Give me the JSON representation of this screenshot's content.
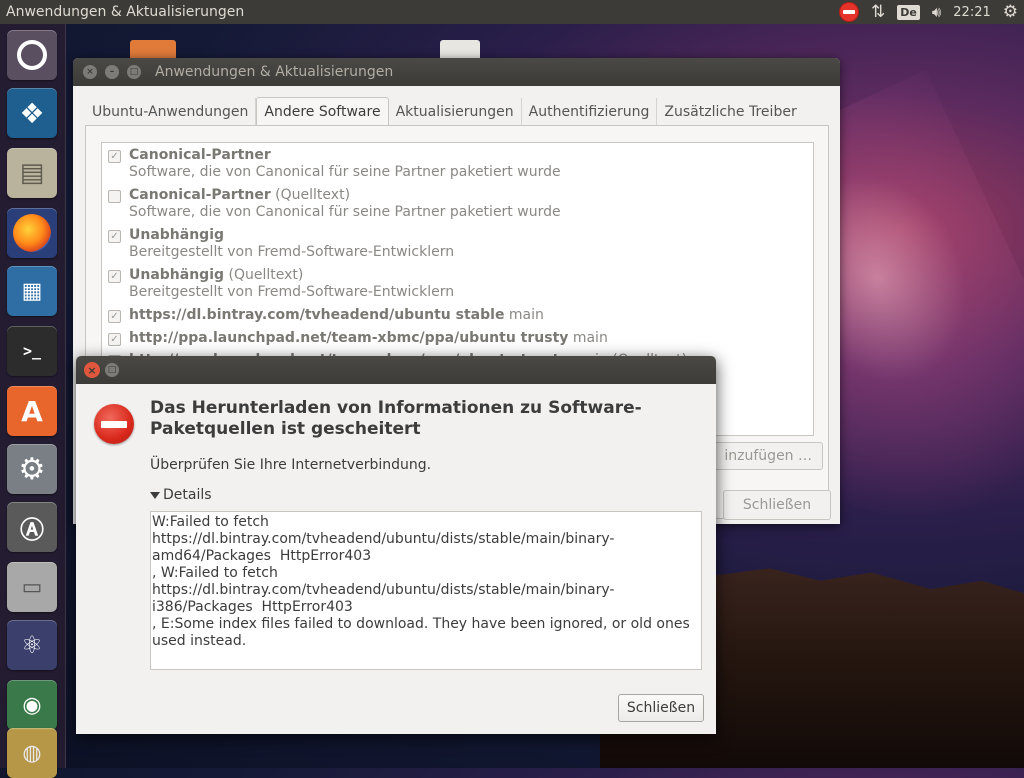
{
  "panel": {
    "title": "Anwendungen & Aktualisierungen",
    "keyboard_layout": "De",
    "clock": "22:21",
    "icons": [
      "network-error-icon",
      "transfer-icon",
      "keyboard-icon",
      "volume-icon",
      "gear-icon"
    ]
  },
  "launcher": {
    "items": [
      "dash-icon",
      "kodi-icon",
      "file-manager-icon",
      "firefox-icon",
      "writer-icon",
      "terminal-icon",
      "software-center-icon",
      "system-settings-icon",
      "software-updater-icon",
      "disk-icon",
      "media-icon",
      "app-icon",
      "app-icon"
    ]
  },
  "bg_window": {
    "title": "Anwendungen & Aktualisierungen",
    "tabs": [
      "Ubuntu-Anwendungen",
      "Andere Software",
      "Aktualisierungen",
      "Authentifizierung",
      "Zusätzliche Treiber"
    ],
    "active_tab": "Andere Software",
    "sources": [
      {
        "name": "Canonical-Partner",
        "suffix": "",
        "desc": "Software, die von Canonical für seine Partner paketiert wurde",
        "checked": true
      },
      {
        "name": "Canonical-Partner",
        "suffix": " (Quelltext)",
        "desc": "Software, die von Canonical für seine Partner paketiert wurde",
        "checked": false
      },
      {
        "name": "Unabhängig",
        "suffix": "",
        "desc": "Bereitgestellt von Fremd-Software-Entwicklern",
        "checked": true
      },
      {
        "name": "Unabhängig",
        "suffix": " (Quelltext)",
        "desc": "Bereitgestellt von Fremd-Software-Entwicklern",
        "checked": true
      },
      {
        "name": "https://dl.bintray.com/tvheadend/ubuntu stable",
        "suffix": " main",
        "desc": "",
        "checked": true
      },
      {
        "name": "http://ppa.launchpad.net/team-xbmc/ppa/ubuntu trusty",
        "suffix": " main",
        "desc": "",
        "checked": true
      },
      {
        "name": "http://ppa.launchpad.net/team-xbmc/ppa/ubuntu trusty",
        "suffix": " main (Quelltext)",
        "desc": "",
        "checked": false
      }
    ],
    "add_button_partial": "inzufügen …",
    "close_button": "Schließen"
  },
  "dialog": {
    "heading": "Das Herunterladen von Informationen zu Software-Paketquellen ist gescheitert",
    "message": "Überprüfen Sie Ihre Internetverbindung.",
    "details_label": "Details",
    "details_text": "W:Failed to fetch https://dl.bintray.com/tvheadend/ubuntu/dists/stable/main/binary-amd64/Packages  HttpError403\n, W:Failed to fetch https://dl.bintray.com/tvheadend/ubuntu/dists/stable/main/binary-i386/Packages  HttpError403\n, E:Some index files failed to download. They have been ignored, or old ones used instead.",
    "close_button": "Schließen"
  }
}
